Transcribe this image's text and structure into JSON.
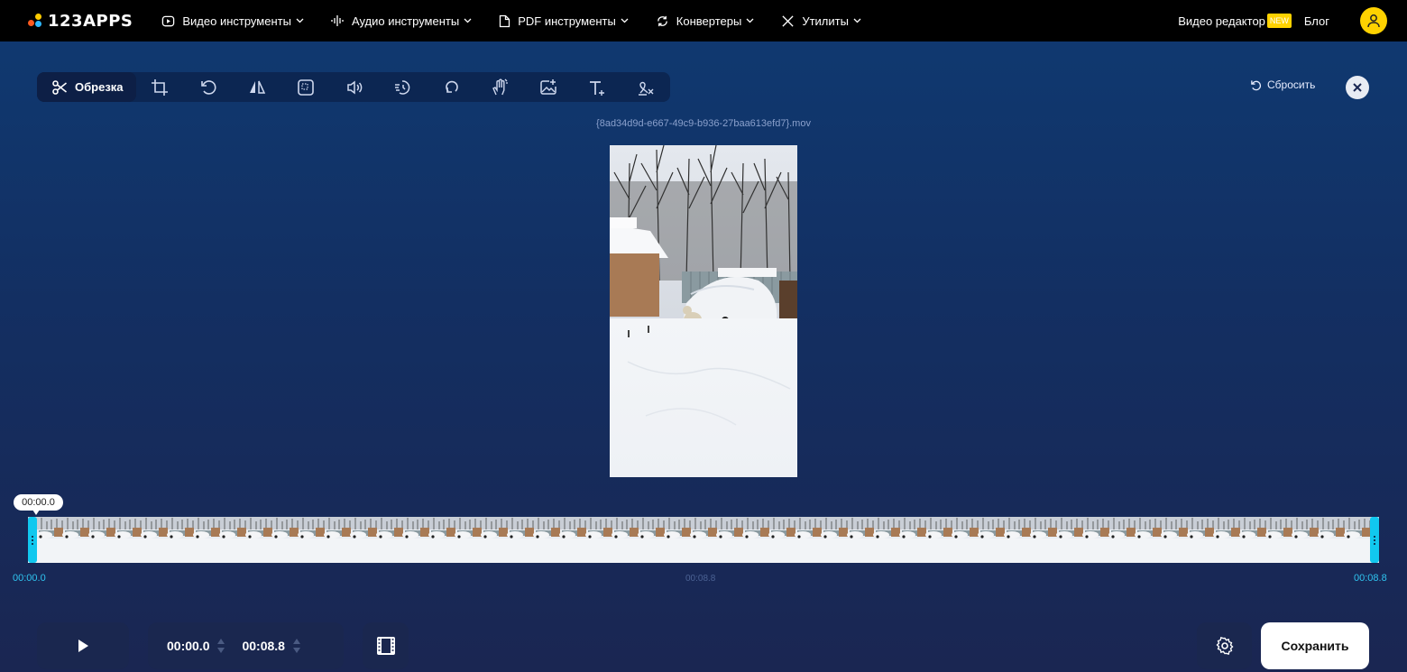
{
  "header": {
    "logo_text": "123APPS",
    "nav": [
      {
        "label": "Видео инструменты",
        "icon": "video-icon"
      },
      {
        "label": "Аудио инструменты",
        "icon": "audio-wave-icon"
      },
      {
        "label": "PDF инструменты",
        "icon": "pdf-icon"
      },
      {
        "label": "Конвертеры",
        "icon": "convert-icon"
      },
      {
        "label": "Утилиты",
        "icon": "tools-icon"
      }
    ],
    "video_editor_label": "Видео редактор",
    "new_badge": "NEW",
    "blog_label": "Блог"
  },
  "toolbar": {
    "active_tool_label": "Обрезка",
    "tools": [
      "crop-icon",
      "rotate-icon",
      "flip-icon",
      "resize-icon",
      "volume-icon",
      "speed-icon",
      "loop-icon",
      "stabilize-icon",
      "image-icon",
      "text-icon",
      "remove-logo-icon"
    ],
    "reset_label": "Сбросить"
  },
  "editor": {
    "filename": "{8ad34d9d-e667-49c9-b936-27baa613efd7}.mov"
  },
  "timeline": {
    "cursor_time": "00:00.0",
    "start_time": "00:00.0",
    "mid_time": "00:08.8",
    "end_time": "00:08.8"
  },
  "controls": {
    "trim_start": "00:00.0",
    "trim_end": "00:08.8",
    "save_label": "Сохранить"
  },
  "colors": {
    "accent": "#11c8ef",
    "badge": "#ffd200",
    "background_top": "#0f3a72",
    "background_bottom": "#1a2652"
  }
}
